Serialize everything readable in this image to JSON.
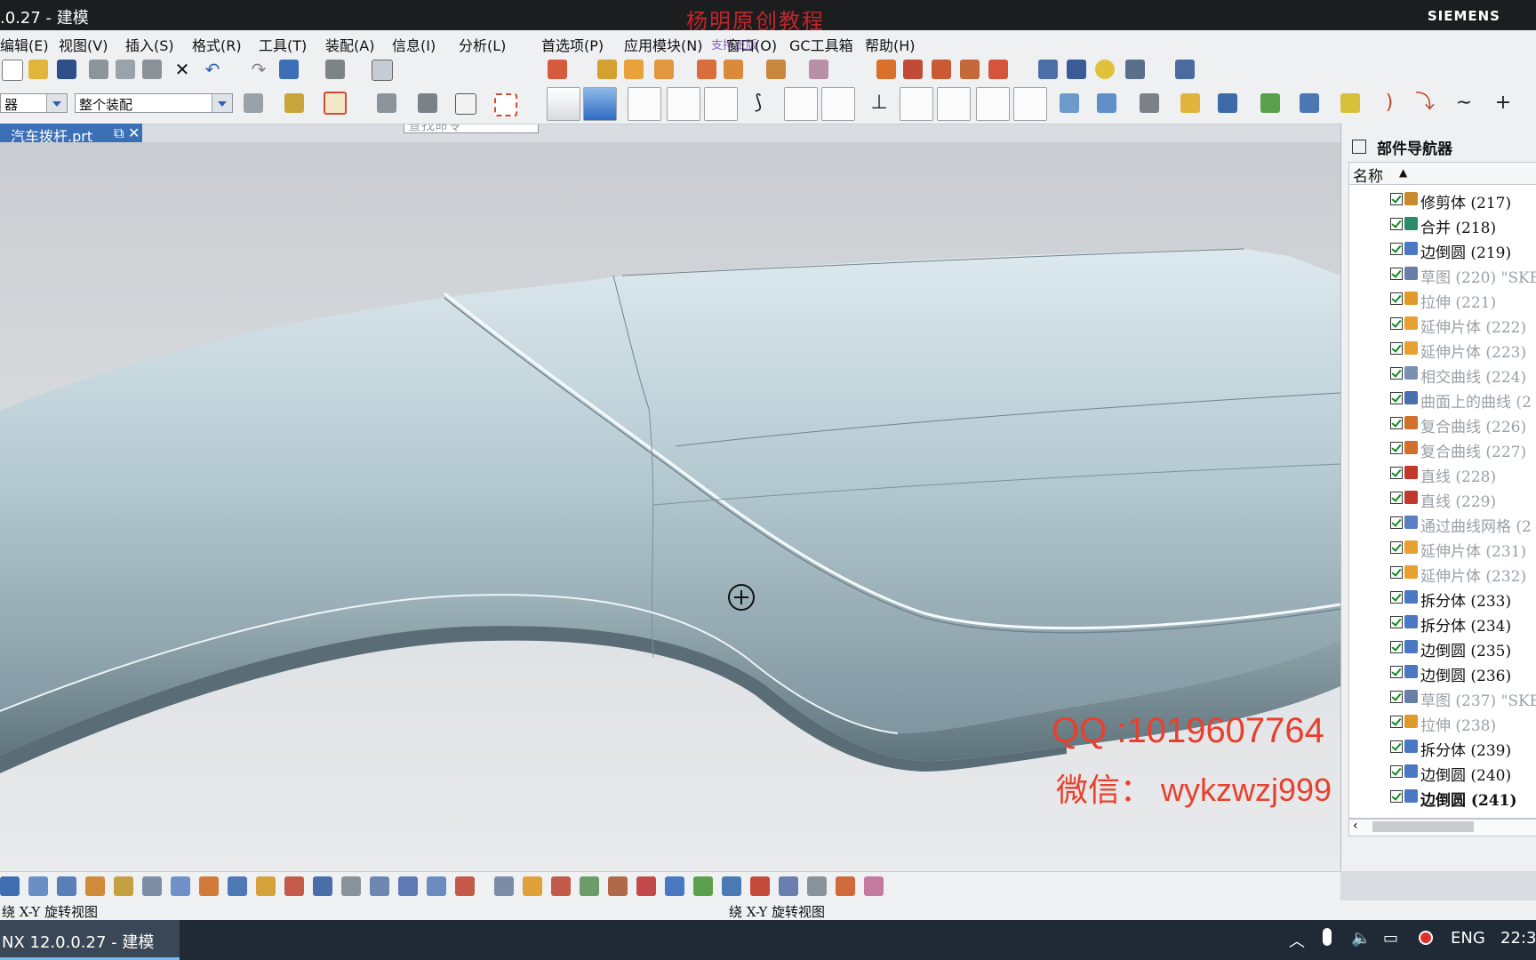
{
  "window": {
    "title": ".0.27 - 建模",
    "watermark_top": "杨明原创教程",
    "brand": "SIEMENS"
  },
  "menu": {
    "items": [
      "编辑(E)",
      "视图(V)",
      "插入(S)",
      "格式(R)",
      "工具(T)",
      "装配(A)",
      "信息(I)",
      "分析(L)",
      "首选项(P)",
      "应用模块(N)",
      "窗口(O)",
      "GC工具箱",
      "帮助(H)"
    ],
    "overlay_text": "支持正版"
  },
  "toolbar": {
    "search_placeholder": "查找命令",
    "filter_combo": "器",
    "assembly_combo": "整个装配"
  },
  "file_tab": {
    "label": "汽车拨杆.prt"
  },
  "viewport": {
    "watermark_qq": "QQ :1019607764",
    "watermark_wechat": "微信： wykzwzj999"
  },
  "navigator": {
    "title": "部件导航器",
    "column": "名称",
    "items": [
      {
        "label": "修剪体 (217)",
        "state": "norm",
        "icon": "trim-body-icon",
        "color": "#c98a2d"
      },
      {
        "label": "合并 (218)",
        "state": "norm",
        "icon": "unite-icon",
        "color": "#2a8c6a"
      },
      {
        "label": "边倒圆 (219)",
        "state": "norm",
        "icon": "edge-blend-icon",
        "color": "#4a78c2"
      },
      {
        "label": "草图 (220) \"SKE",
        "state": "sup",
        "icon": "sketch-icon",
        "color": "#6a7fa8"
      },
      {
        "label": "拉伸 (221)",
        "state": "sup",
        "icon": "extrude-icon",
        "color": "#e09a2a"
      },
      {
        "label": "延伸片体 (222)",
        "state": "sup",
        "icon": "extend-sheet-icon",
        "color": "#e8a030"
      },
      {
        "label": "延伸片体 (223)",
        "state": "sup",
        "icon": "extend-sheet-icon",
        "color": "#e8a030"
      },
      {
        "label": "相交曲线 (224)",
        "state": "sup",
        "icon": "intersect-curve-icon",
        "color": "#7b8fb3"
      },
      {
        "label": "曲面上的曲线 (2",
        "state": "sup",
        "icon": "curve-on-surface-icon",
        "color": "#4a6fb0"
      },
      {
        "label": "复合曲线 (226)",
        "state": "sup",
        "icon": "composite-curve-icon",
        "color": "#d0702a"
      },
      {
        "label": "复合曲线 (227)",
        "state": "sup",
        "icon": "composite-curve-icon",
        "color": "#d0702a"
      },
      {
        "label": "直线 (228)",
        "state": "sup",
        "icon": "line-icon",
        "color": "#c0392b"
      },
      {
        "label": "直线 (229)",
        "state": "sup",
        "icon": "line-icon",
        "color": "#c0392b"
      },
      {
        "label": "通过曲线网格 (2",
        "state": "sup",
        "icon": "curve-mesh-icon",
        "color": "#5b7fc4"
      },
      {
        "label": "延伸片体 (231)",
        "state": "sup",
        "icon": "extend-sheet-icon",
        "color": "#e8a030"
      },
      {
        "label": "延伸片体 (232)",
        "state": "sup",
        "icon": "extend-sheet-icon",
        "color": "#e8a030"
      },
      {
        "label": "拆分体 (233)",
        "state": "norm",
        "icon": "split-body-icon",
        "color": "#4a78c2"
      },
      {
        "label": "拆分体 (234)",
        "state": "norm",
        "icon": "split-body-icon",
        "color": "#4a78c2"
      },
      {
        "label": "边倒圆 (235)",
        "state": "norm",
        "icon": "edge-blend-icon",
        "color": "#4a78c2"
      },
      {
        "label": "边倒圆 (236)",
        "state": "norm",
        "icon": "edge-blend-icon",
        "color": "#4a78c2"
      },
      {
        "label": "草图 (237) \"SKE",
        "state": "sup",
        "icon": "sketch-icon",
        "color": "#6a7fa8"
      },
      {
        "label": "拉伸 (238)",
        "state": "sup",
        "icon": "extrude-icon",
        "color": "#e09a2a"
      },
      {
        "label": "拆分体 (239)",
        "state": "norm",
        "icon": "split-body-icon",
        "color": "#4a78c2"
      },
      {
        "label": "边倒圆 (240)",
        "state": "norm",
        "icon": "edge-blend-icon",
        "color": "#4a78c2"
      },
      {
        "label": "边倒圆 (241)",
        "state": "last",
        "icon": "edge-blend-icon",
        "color": "#4a78c2"
      }
    ]
  },
  "status": {
    "left": "绕 X-Y 旋转视图",
    "right": "绕 X-Y 旋转视图"
  },
  "taskbar": {
    "app": "NX 12.0.0.27 - 建模",
    "lang": "ENG",
    "time": "22:3"
  },
  "colors": {
    "accent": "#3b6fb6",
    "watermark": "#e8402c",
    "surface": "#b9cdd6"
  }
}
